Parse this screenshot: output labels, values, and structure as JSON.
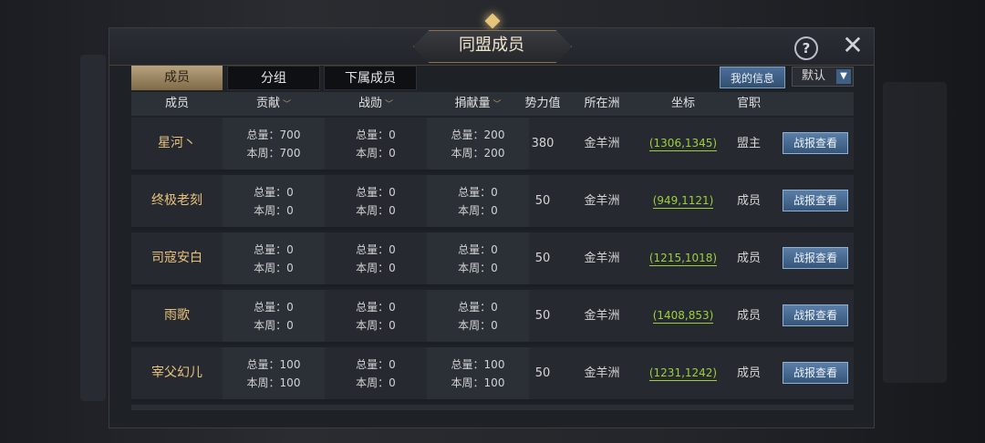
{
  "title": "同盟成员",
  "tabs": [
    {
      "label": "成员"
    },
    {
      "label": "分组"
    },
    {
      "label": "下属成员"
    }
  ],
  "my_info_label": "我的信息",
  "sort": {
    "value": "默认"
  },
  "columns": {
    "member": "成员",
    "contribution": "贡献",
    "merit": "战勋",
    "donation": "捐献量",
    "power": "势力值",
    "region": "所在洲",
    "coords": "坐标",
    "office": "官职"
  },
  "members": [
    {
      "name": "星河丶",
      "contrib_total": "总量：700",
      "contrib_week": "本周：700",
      "merit_total": "总量：0",
      "merit_week": "本周：0",
      "donate_total": "总量：200",
      "donate_week": "本周：200",
      "power": "380",
      "region": "金羊洲",
      "coords": "(1306,1345)",
      "office": "盟主",
      "report": "战报查看"
    },
    {
      "name": "终极老刻",
      "contrib_total": "总量：0",
      "contrib_week": "本周：0",
      "merit_total": "总量：0",
      "merit_week": "本周：0",
      "donate_total": "总量：0",
      "donate_week": "本周：0",
      "power": "50",
      "region": "金羊洲",
      "coords": "(949,1121)",
      "office": "成员",
      "report": "战报查看"
    },
    {
      "name": "司寇安白",
      "contrib_total": "总量：0",
      "contrib_week": "本周：0",
      "merit_total": "总量：0",
      "merit_week": "本周：0",
      "donate_total": "总量：0",
      "donate_week": "本周：0",
      "power": "50",
      "region": "金羊洲",
      "coords": "(1215,1018)",
      "office": "成员",
      "report": "战报查看"
    },
    {
      "name": "雨歌",
      "contrib_total": "总量：0",
      "contrib_week": "本周：0",
      "merit_total": "总量：0",
      "merit_week": "本周：0",
      "donate_total": "总量：0",
      "donate_week": "本周：0",
      "power": "50",
      "region": "金羊洲",
      "coords": "(1408,853)",
      "office": "成员",
      "report": "战报查看"
    },
    {
      "name": "宰父幻儿",
      "contrib_total": "总量：100",
      "contrib_week": "本周：100",
      "merit_total": "总量：0",
      "merit_week": "本周：0",
      "donate_total": "总量：100",
      "donate_week": "本周：100",
      "power": "50",
      "region": "金羊洲",
      "coords": "(1231,1242)",
      "office": "成员",
      "report": "战报查看"
    }
  ]
}
